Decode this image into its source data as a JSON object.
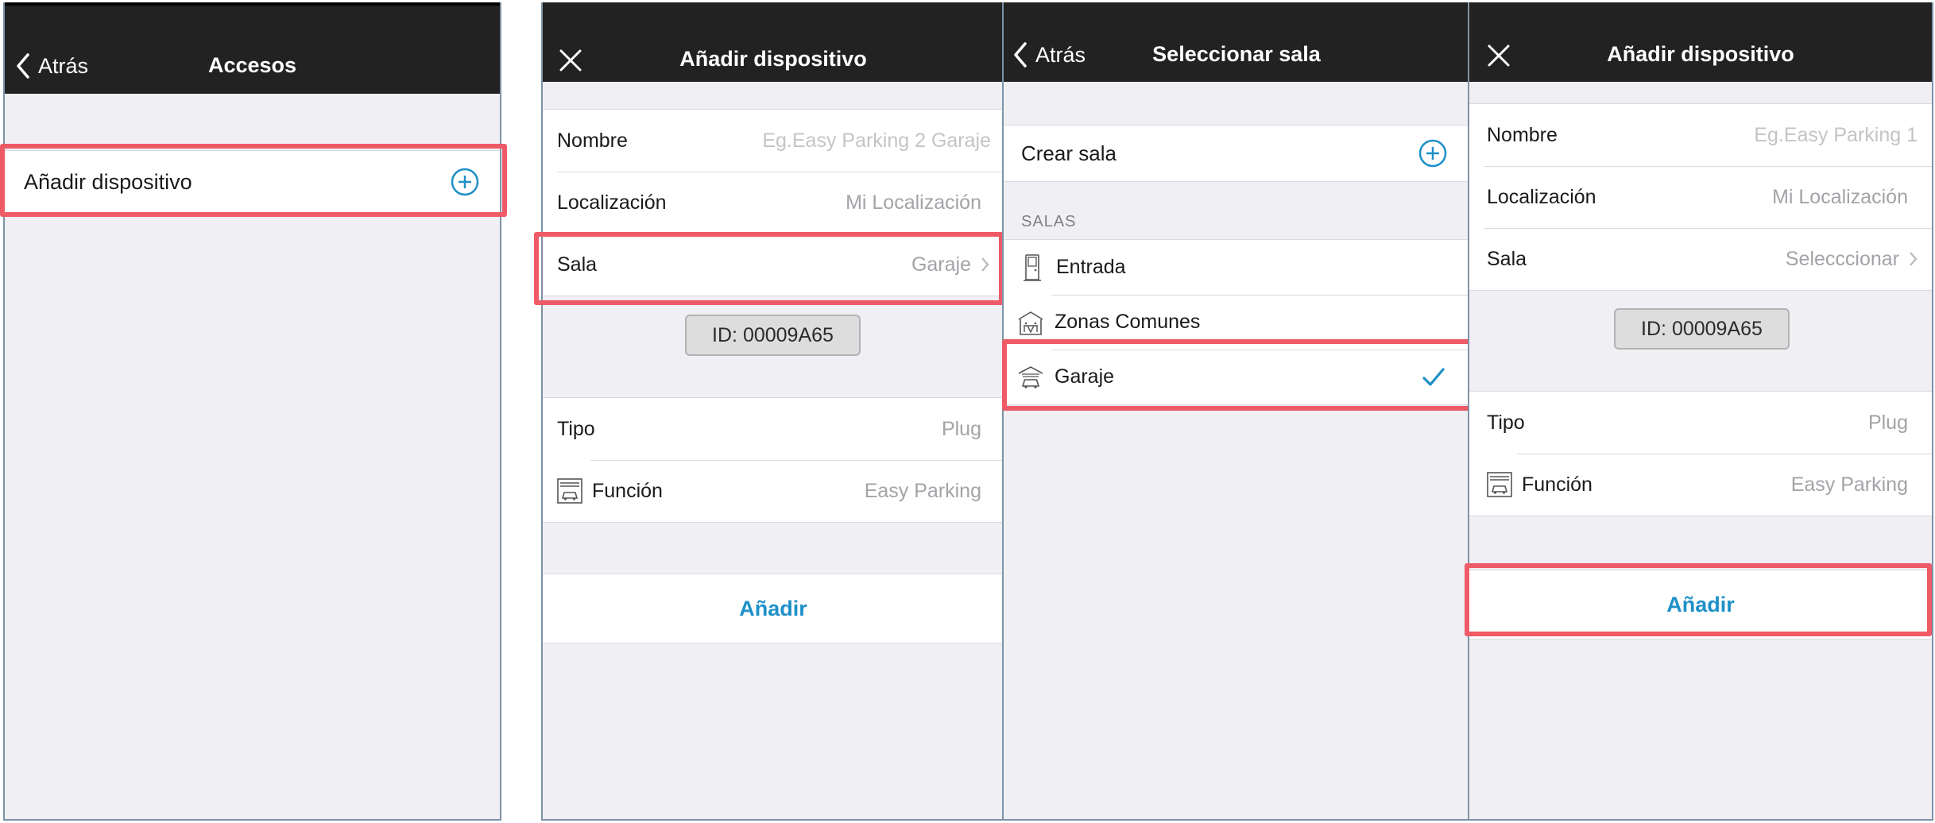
{
  "screen1": {
    "back": "Atrás",
    "title": "Accesos",
    "add_device": "Añadir dispositivo"
  },
  "screen2": {
    "title": "Añadir dispositivo",
    "fields": [
      {
        "label": "Nombre",
        "value": "Eg.Easy Parking 2 Garaje"
      },
      {
        "label": "Localización",
        "value": "Mi Localización"
      },
      {
        "label": "Sala",
        "value": "Garaje"
      }
    ],
    "id_badge": "ID: 00009A65",
    "tipo": {
      "label": "Tipo",
      "value": "Plug"
    },
    "funcion": {
      "label": "Función",
      "value": "Easy Parking"
    },
    "add_button": "Añadir"
  },
  "screen3": {
    "back": "Atrás",
    "title": "Seleccionar sala",
    "create_room": "Crear sala",
    "section": "SALAS",
    "rooms": [
      {
        "name": "Entrada",
        "icon": "door-icon"
      },
      {
        "name": "Zonas Comunes",
        "icon": "common-area-icon"
      },
      {
        "name": "Garaje",
        "icon": "garage-icon",
        "selected": true
      }
    ]
  },
  "screen4": {
    "title": "Añadir dispositivo",
    "fields": [
      {
        "label": "Nombre",
        "value": "Eg.Easy Parking 1"
      },
      {
        "label": "Localización",
        "value": "Mi Localización"
      },
      {
        "label": "Sala",
        "value": "Selecccionar"
      }
    ],
    "id_badge": "ID: 00009A65",
    "tipo": {
      "label": "Tipo",
      "value": "Plug"
    },
    "funcion": {
      "label": "Función",
      "value": "Easy Parking"
    },
    "add_button": "Añadir"
  },
  "colors": {
    "nav_bg": "#222222",
    "accent": "#1e90c8",
    "highlight": "#ef5a67",
    "background": "#efeff4"
  }
}
